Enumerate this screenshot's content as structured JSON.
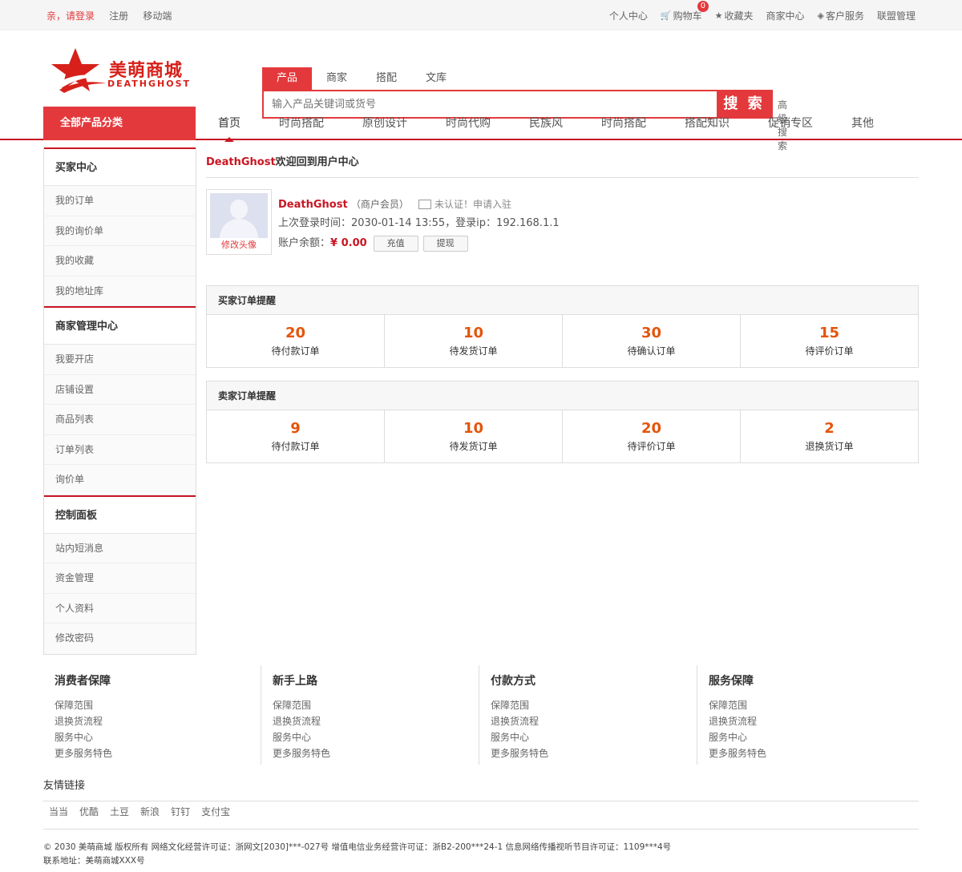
{
  "topbar": {
    "login": "亲，请登录",
    "register": "注册",
    "mobile": "移动端",
    "personal_center": "个人中心",
    "cart": "购物车",
    "cart_count": "0",
    "favorites": "收藏夹",
    "merchant_center": "商家中心",
    "customer_service": "客户服务",
    "alliance": "联盟管理"
  },
  "logo": {
    "name_cn": "美萌商城",
    "name_en": "DEATHGHOST"
  },
  "search": {
    "tabs": [
      "产品",
      "商家",
      "搭配",
      "文库"
    ],
    "active_tab": "产品",
    "placeholder": "输入产品关键词或货号",
    "button": "搜 索",
    "advanced": "高级搜索"
  },
  "nav": {
    "all_categories": "全部产品分类",
    "items": [
      "首页",
      "时尚搭配",
      "原创设计",
      "时尚代购",
      "民族风",
      "时尚搭配",
      "搭配知识",
      "促销专区",
      "其他"
    ]
  },
  "sidebar": {
    "groups": [
      {
        "title": "买家中心",
        "items": [
          "我的订单",
          "我的询价单",
          "我的收藏",
          "我的地址库"
        ]
      },
      {
        "title": "商家管理中心",
        "items": [
          "我要开店",
          "店铺设置",
          "商品列表",
          "订单列表",
          "询价单"
        ]
      },
      {
        "title": "控制面板",
        "items": [
          "站内短消息",
          "资金管理",
          "个人资料",
          "修改密码"
        ]
      }
    ]
  },
  "welcome": {
    "username": "DeathGhost",
    "text": "欢迎回到用户中心"
  },
  "profile": {
    "edit_avatar": "修改头像",
    "name": "DeathGhost",
    "member_type": "（商户会员）",
    "verify_status": "未认证！申请入驻",
    "last_login_label": "上次登录时间：",
    "last_login_time": "2030-01-14 13:55",
    "ip_label": "，登录ip：",
    "ip": "192.168.1.1",
    "balance_label": "账户余额：",
    "balance": "¥ 0.00",
    "recharge": "充值",
    "withdraw": "提现"
  },
  "buyer_orders": {
    "title": "买家订单提醒",
    "stats": [
      {
        "count": "20",
        "label": "待付款订单"
      },
      {
        "count": "10",
        "label": "待发货订单"
      },
      {
        "count": "30",
        "label": "待确认订单"
      },
      {
        "count": "15",
        "label": "待评价订单"
      }
    ]
  },
  "seller_orders": {
    "title": "卖家订单提醒",
    "stats": [
      {
        "count": "9",
        "label": "待付款订单"
      },
      {
        "count": "10",
        "label": "待发货订单"
      },
      {
        "count": "20",
        "label": "待评价订单"
      },
      {
        "count": "2",
        "label": "退换货订单"
      }
    ]
  },
  "footer": {
    "columns": [
      {
        "title": "消费者保障",
        "links": [
          "保障范围",
          "退换货流程",
          "服务中心",
          "更多服务特色"
        ]
      },
      {
        "title": "新手上路",
        "links": [
          "保障范围",
          "退换货流程",
          "服务中心",
          "更多服务特色"
        ]
      },
      {
        "title": "付款方式",
        "links": [
          "保障范围",
          "退换货流程",
          "服务中心",
          "更多服务特色"
        ]
      },
      {
        "title": "服务保障",
        "links": [
          "保障范围",
          "退换货流程",
          "服务中心",
          "更多服务特色"
        ]
      }
    ],
    "friend_title": "友情链接",
    "friend_links": [
      "当当",
      "优酷",
      "土豆",
      "新浪",
      "钉钉",
      "支付宝"
    ],
    "copyright": "© 2030 美萌商城 版权所有 网络文化经营许可证：浙网文[2030]***-027号 增值电信业务经营许可证：浙B2-200***24-1 信息网络传播视听节目许可证：1109***4号",
    "address": "联系地址：美萌商城XXX号"
  },
  "colors": {
    "brand_red": "#e4393c",
    "nav_red": "#c81623",
    "stat_orange": "#e4550b"
  }
}
